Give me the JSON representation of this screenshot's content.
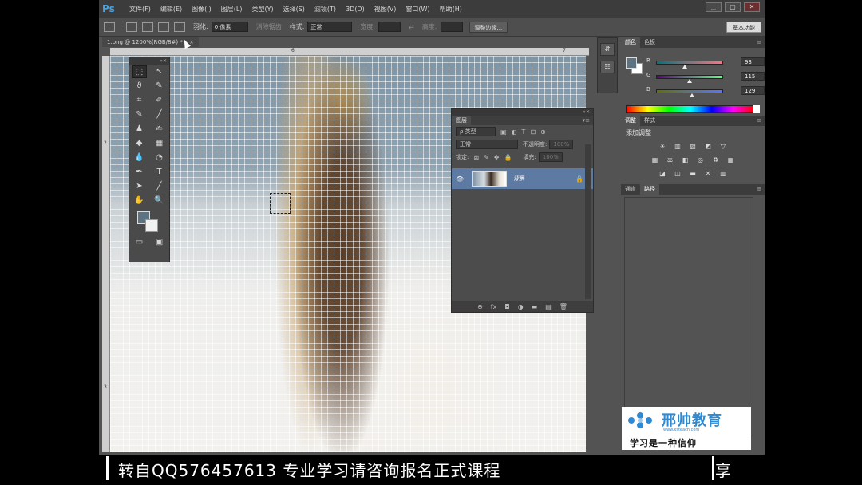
{
  "app": {
    "logo": "Ps"
  },
  "menu": [
    "文件(F)",
    "编辑(E)",
    "图像(I)",
    "图层(L)",
    "类型(Y)",
    "选择(S)",
    "滤镜(T)",
    "3D(D)",
    "视图(V)",
    "窗口(W)",
    "帮助(H)"
  ],
  "window_controls": {
    "minimize": "▁",
    "maximize": "▢",
    "close": "✕"
  },
  "options": {
    "feather_label": "羽化:",
    "feather_value": "0 像素",
    "antialias_label": "消除锯齿",
    "style_label": "样式:",
    "style_value": "正常",
    "width_label": "宽度:",
    "height_label": "高度:",
    "refine_button": "调整边缘...",
    "workspace_button": "基本功能"
  },
  "document": {
    "tab_title": "1.png @ 1200%(RGB/8#) *",
    "close": "×"
  },
  "ruler": {
    "h_ticks": [
      "6",
      "7"
    ],
    "v_ticks": [
      "2",
      "3"
    ]
  },
  "tools": {
    "rows": [
      [
        "⬚",
        "↖"
      ],
      [
        "ϑ",
        "✎"
      ],
      [
        "⌗",
        "✐"
      ],
      [
        "✎",
        "╱"
      ],
      [
        "♟",
        "✍"
      ],
      [
        "◆",
        "▦"
      ],
      [
        "💧",
        "◔"
      ],
      [
        "✒",
        "T"
      ],
      [
        "➤",
        "╱"
      ],
      [
        "✋",
        "🔍"
      ]
    ],
    "bottom": [
      "▭",
      "▣"
    ]
  },
  "layers": {
    "panel_tab": "图层",
    "filter_kind": "ρ 类型",
    "filter_icons": [
      "▣",
      "◐",
      "T",
      "⊡",
      "⊕"
    ],
    "blend_mode": "正常",
    "opacity_label": "不透明度:",
    "opacity_value": "100%",
    "lock_label": "锁定:",
    "lock_icons": [
      "⊠",
      "✎",
      "✥",
      "🔒"
    ],
    "fill_label": "填充:",
    "fill_value": "100%",
    "layer_name": "背景",
    "eye": "👁",
    "lock": "🔒",
    "bottom_icons": [
      "⊖",
      "fx",
      "◘",
      "◑",
      "▬",
      "▤",
      "🗑"
    ]
  },
  "dock": {
    "buttons": [
      "⇵",
      "☷"
    ]
  },
  "color_panel": {
    "tabs": [
      "颜色",
      "色板"
    ],
    "r_label": "R",
    "r_value": "93",
    "g_label": "G",
    "g_value": "115",
    "b_label": "B",
    "b_value": "129",
    "fg_color": "#5d7381"
  },
  "adjust_panel": {
    "tabs": [
      "调整",
      "样式"
    ],
    "title": "添加调整",
    "row1": [
      "☀",
      "▥",
      "▨",
      "◩",
      "▽"
    ],
    "row2": [
      "▦",
      "⚖",
      "◧",
      "◎",
      "♻",
      "▦"
    ],
    "row3": [
      "◪",
      "◫",
      "▬",
      "✕",
      "▥"
    ]
  },
  "paths_panel": {
    "tabs": [
      "通道",
      "路径"
    ]
  },
  "watermark": {
    "brand": "邢帅教育",
    "url": "www.xsteach.com",
    "slogan": "学习是一种信仰"
  },
  "caption": {
    "text": "转自QQ576457613 专业学习请咨询报名正式课程",
    "tail": "享"
  }
}
